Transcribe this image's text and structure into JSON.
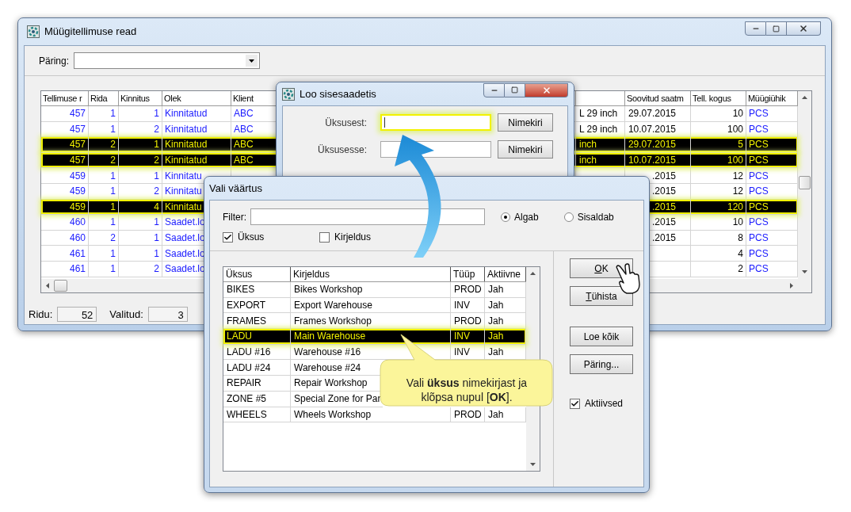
{
  "main_window": {
    "title": "Müügitellimuse read",
    "query_label": "Päring:",
    "table": {
      "columns_left": [
        "Tellimuse r",
        "Rida",
        "Kinnitus",
        "Olek",
        "Klient"
      ],
      "columns_right": [
        "Soovitud saatm",
        "Tell. kogus",
        "Müügiühik"
      ],
      "rows": [
        {
          "order": "457",
          "line": "1",
          "confirmation": "1",
          "status": "Kinnitatud",
          "client": "ABC",
          "column_6": "L 29 inch",
          "desired_date": "29.07.2015",
          "quantity": "10",
          "unit": "PCS",
          "selected": false
        },
        {
          "order": "457",
          "line": "1",
          "confirmation": "2",
          "status": "Kinnitatud",
          "client": "ABC",
          "column_6": "L 29 inch",
          "desired_date": "10.07.2015",
          "quantity": "100",
          "unit": "PCS",
          "selected": false
        },
        {
          "order": "457",
          "line": "2",
          "confirmation": "1",
          "status": "Kinnitatud",
          "client": "ABC",
          "column_6": "inch",
          "desired_date": "29.07.2015",
          "quantity": "5",
          "unit": "PCS",
          "selected": true
        },
        {
          "order": "457",
          "line": "2",
          "confirmation": "2",
          "status": "Kinnitatud",
          "client": "ABC",
          "column_6": "inch",
          "desired_date": "10.07.2015",
          "quantity": "100",
          "unit": "PCS",
          "selected": true
        },
        {
          "order": "459",
          "line": "1",
          "confirmation": "1",
          "status": "Kinnitatu",
          "desired_date": ".2015",
          "quantity": "12",
          "unit": "PCS",
          "selected": false
        },
        {
          "order": "459",
          "line": "1",
          "confirmation": "2",
          "status": "Kinnitatu",
          "desired_date": ".2015",
          "quantity": "12",
          "unit": "PCS",
          "selected": false
        },
        {
          "order": "459",
          "line": "1",
          "confirmation": "4",
          "status": "Kinnitatu",
          "desired_date": ".2015",
          "quantity": "120",
          "unit": "PCS",
          "selected": true
        },
        {
          "order": "460",
          "line": "1",
          "confirmation": "1",
          "status": "Saadet.lo",
          "desired_date": ".2015",
          "quantity": "10",
          "unit": "PCS",
          "selected": false
        },
        {
          "order": "460",
          "line": "2",
          "confirmation": "1",
          "status": "Saadet.lo",
          "desired_date": ".2015",
          "quantity": "8",
          "unit": "PCS",
          "selected": false
        },
        {
          "order": "461",
          "line": "1",
          "confirmation": "1",
          "status": "Saadet.lo",
          "quantity": "4",
          "unit": "PCS",
          "selected": false
        },
        {
          "order": "461",
          "line": "1",
          "confirmation": "2",
          "status": "Saadet.lo",
          "quantity": "2",
          "unit": "PCS",
          "selected": false
        }
      ]
    },
    "status": [
      {
        "label": "Ridu:",
        "value": "52"
      },
      {
        "label": "Valitud:",
        "value": "3"
      }
    ]
  },
  "create_dialog": {
    "title": "Loo sisesaadetis",
    "fields": [
      {
        "label": "Üksusest:",
        "highlighted": true,
        "button": "Nimekiri"
      },
      {
        "label": "Üksusesse:",
        "highlighted": false,
        "button": "Nimekiri"
      }
    ]
  },
  "pick_dialog": {
    "title": "Vali väärtus",
    "filter_label": "Filter:",
    "match_options": [
      {
        "label": "Algab",
        "selected": true
      },
      {
        "label": "Sisaldab",
        "selected": false
      }
    ],
    "search_in": [
      {
        "label": "Üksus",
        "checked": true
      },
      {
        "label": "Kirjeldus",
        "checked": false
      }
    ],
    "list": {
      "columns": [
        "Üksus",
        "Kirjeldus",
        "Tüüp",
        "Aktiivne"
      ],
      "rows": [
        {
          "unit": "BIKES",
          "description": "Bikes Workshop",
          "type": "PROD",
          "active": "Jah",
          "selected": false
        },
        {
          "unit": "EXPORT",
          "description": "Export Warehouse",
          "type": "INV",
          "active": "Jah",
          "selected": false
        },
        {
          "unit": "FRAMES",
          "description": "Frames Workshop",
          "type": "PROD",
          "active": "Jah",
          "selected": false
        },
        {
          "unit": "LADU",
          "description": "Main Warehouse",
          "type": "INV",
          "active": "Jah",
          "selected": true
        },
        {
          "unit": "LADU #16",
          "description": "Warehouse #16",
          "type": "INV",
          "active": "Jah",
          "selected": false
        },
        {
          "unit": "LADU #24",
          "description": "Warehouse #24",
          "selected": false
        },
        {
          "unit": "REPAIR",
          "description": "Repair Workshop",
          "selected": false
        },
        {
          "unit": "ZONE #5",
          "description": "Special Zone for Par",
          "selected": false
        },
        {
          "unit": "WHEELS",
          "description": "Wheels Workshop",
          "type": "PROD",
          "active": "Jah",
          "selected": false
        }
      ]
    },
    "buttons": [
      {
        "label": "OK",
        "mnemonic": true
      },
      {
        "label": "Tühista",
        "mnemonic": true
      },
      {
        "label": "Loe kõik",
        "mnemonic": false
      },
      {
        "label": "Päring...",
        "mnemonic": false
      }
    ],
    "active_only": {
      "label": "Aktiivsed",
      "checked": true
    }
  },
  "callout": {
    "text": "Vali **üksus** nimekirjast ja klõpsa nupul [**OK**]."
  }
}
